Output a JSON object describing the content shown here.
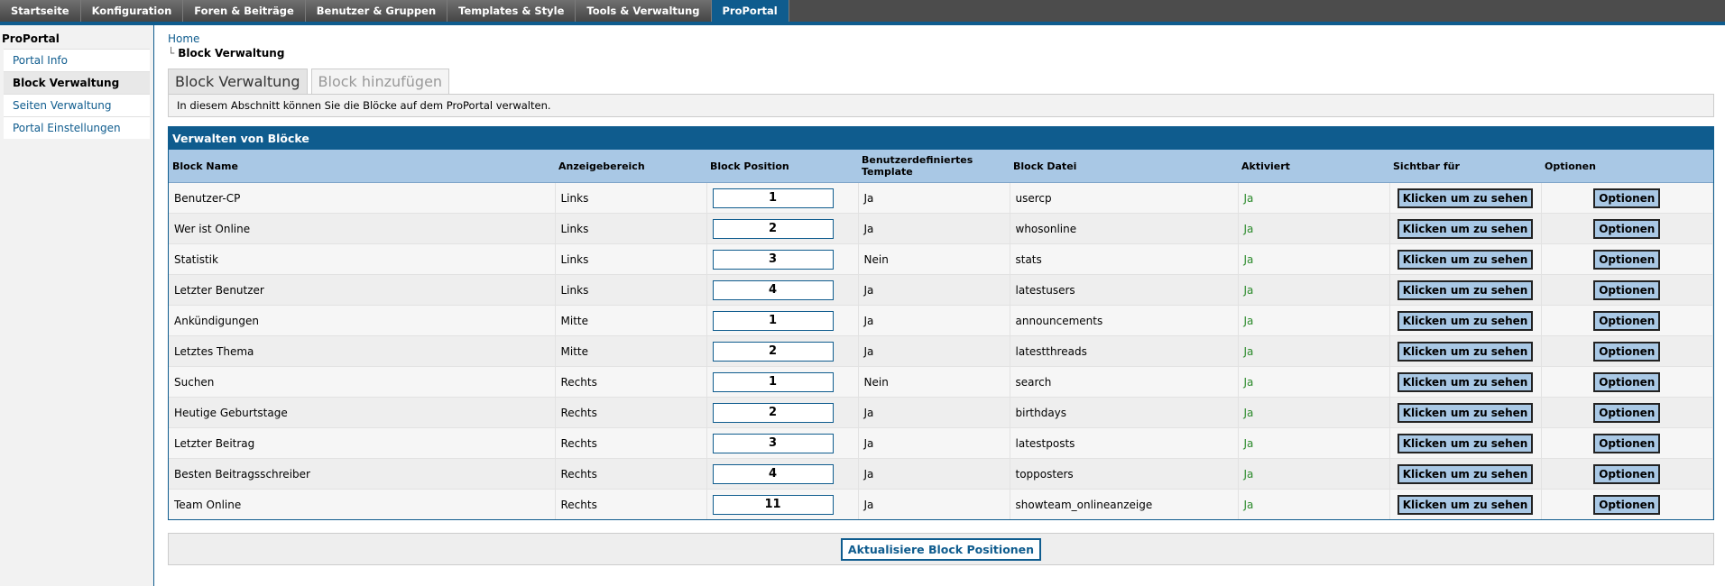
{
  "topnav": [
    "Startseite",
    "Konfiguration",
    "Foren & Beiträge",
    "Benutzer & Gruppen",
    "Templates & Style",
    "Tools & Verwaltung",
    "ProPortal"
  ],
  "sidebar": {
    "title": "ProPortal",
    "items": [
      "Portal Info",
      "Block Verwaltung",
      "Seiten Verwaltung",
      "Portal Einstellungen"
    ]
  },
  "breadcrumb": {
    "home": "Home",
    "tree": "└",
    "current": "Block Verwaltung"
  },
  "tabs": [
    "Block Verwaltung",
    "Block hinzufügen"
  ],
  "description": "In diesem Abschnitt können Sie die Blöcke auf dem ProPortal verwalten.",
  "panel": {
    "title": "Verwalten von Blöcke",
    "columns": [
      "Block Name",
      "Anzeigebereich",
      "Block Position",
      "Benutzerdefiniertes Template",
      "Block Datei",
      "Aktiviert",
      "Sichtbar für",
      "Optionen"
    ],
    "visible_label": "Klicken um zu sehen",
    "options_label": "Optionen",
    "rows": [
      {
        "name": "Benutzer-CP",
        "area": "Links",
        "pos": "1",
        "tpl": "Ja",
        "file": "usercp",
        "active": "Ja"
      },
      {
        "name": "Wer ist Online",
        "area": "Links",
        "pos": "2",
        "tpl": "Ja",
        "file": "whosonline",
        "active": "Ja"
      },
      {
        "name": "Statistik",
        "area": "Links",
        "pos": "3",
        "tpl": "Nein",
        "file": "stats",
        "active": "Ja"
      },
      {
        "name": "Letzter Benutzer",
        "area": "Links",
        "pos": "4",
        "tpl": "Ja",
        "file": "latestusers",
        "active": "Ja"
      },
      {
        "name": "Ankündigungen",
        "area": "Mitte",
        "pos": "1",
        "tpl": "Ja",
        "file": "announcements",
        "active": "Ja"
      },
      {
        "name": "Letztes Thema",
        "area": "Mitte",
        "pos": "2",
        "tpl": "Ja",
        "file": "latestthreads",
        "active": "Ja"
      },
      {
        "name": "Suchen",
        "area": "Rechts",
        "pos": "1",
        "tpl": "Nein",
        "file": "search",
        "active": "Ja"
      },
      {
        "name": "Heutige Geburtstage",
        "area": "Rechts",
        "pos": "2",
        "tpl": "Ja",
        "file": "birthdays",
        "active": "Ja"
      },
      {
        "name": "Letzter Beitrag",
        "area": "Rechts",
        "pos": "3",
        "tpl": "Ja",
        "file": "latestposts",
        "active": "Ja"
      },
      {
        "name": "Besten Beitragsschreiber",
        "area": "Rechts",
        "pos": "4",
        "tpl": "Ja",
        "file": "topposters",
        "active": "Ja"
      },
      {
        "name": "Team Online",
        "area": "Rechts",
        "pos": "11",
        "tpl": "Ja",
        "file": "showteam_onlineanzeige",
        "active": "Ja"
      }
    ]
  },
  "update_button": "Aktualisiere Block Positionen"
}
